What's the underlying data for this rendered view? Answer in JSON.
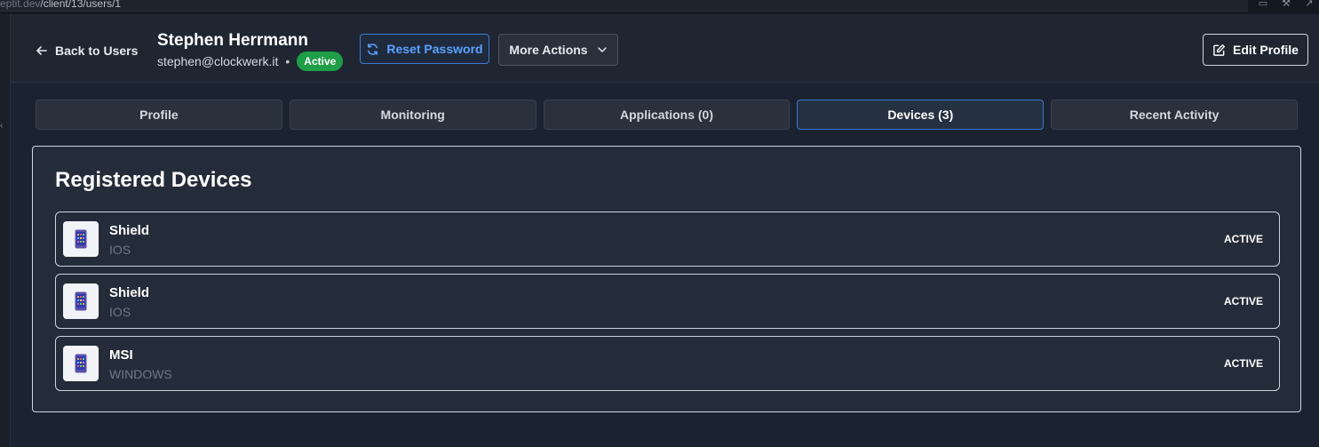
{
  "browser": {
    "url_prefix": "eptit.dev",
    "url_path": "/client/13/users/1"
  },
  "header": {
    "back_label": "Back to Users",
    "user_name": "Stephen Herrmann",
    "user_email": "stephen@clockwerk.it",
    "separator": "•",
    "status": "Active",
    "reset_label": "Reset Password",
    "more_label": "More Actions",
    "edit_label": "Edit Profile"
  },
  "tabs": [
    {
      "label": "Profile"
    },
    {
      "label": "Monitoring"
    },
    {
      "label": "Applications (0)"
    },
    {
      "label": "Devices (3)"
    },
    {
      "label": "Recent Activity"
    }
  ],
  "devices_section": {
    "title": "Registered Devices",
    "devices": [
      {
        "name": "Shield",
        "os": "IOS",
        "status": "ACTIVE"
      },
      {
        "name": "Shield",
        "os": "IOS",
        "status": "ACTIVE"
      },
      {
        "name": "MSI",
        "os": "WINDOWS",
        "status": "ACTIVE"
      }
    ]
  },
  "colors": {
    "accent": "#3a7bd5",
    "status_green": "#1f9d47",
    "background": "#1b2230"
  },
  "icons": {
    "back": "arrow-left-icon",
    "reset": "refresh-icon",
    "more": "chevron-down-icon",
    "edit": "edit-icon",
    "device": "mobile-phone-icon"
  }
}
